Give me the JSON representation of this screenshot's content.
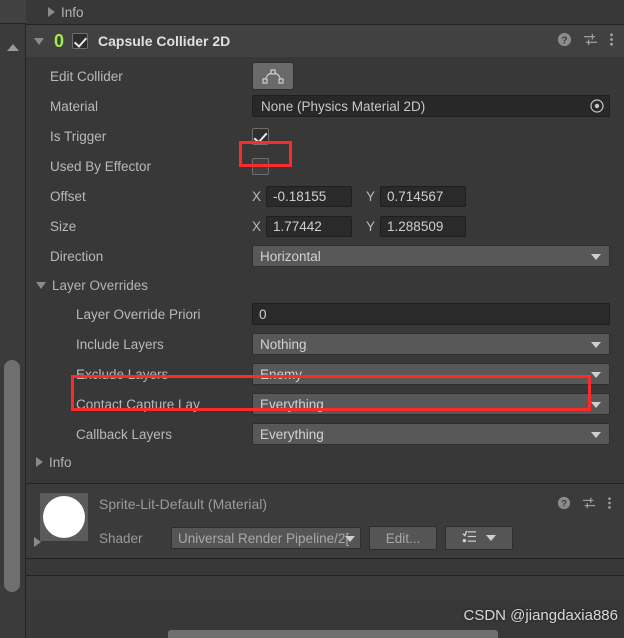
{
  "window": {
    "background_color": "#383838",
    "accent_highlight_color": "#fc2b2b",
    "component_icon_color": "#9cef4a"
  },
  "top_info_row": {
    "label": "Info",
    "expanded": false,
    "triangle_icon": "triangle-right-icon"
  },
  "component_header": {
    "foldout_icon": "triangle-down-icon",
    "component_icon": "0",
    "enabled": true,
    "title": "Capsule Collider 2D",
    "icons": [
      {
        "name": "help-icon",
        "glyph": "?"
      },
      {
        "name": "preset-icon",
        "glyph": "sliders"
      },
      {
        "name": "more-menu-icon",
        "glyph": "kebab"
      }
    ]
  },
  "fields": {
    "edit_collider": {
      "label": "Edit Collider",
      "button_icon": "collider-edit-icon"
    },
    "material": {
      "label": "Material",
      "value": "None (Physics Material 2D)",
      "picker_icon": "object-picker-icon"
    },
    "is_trigger": {
      "label": "Is Trigger",
      "checked": true,
      "highlighted": true
    },
    "used_by_effector": {
      "label": "Used By Effector",
      "checked": false
    },
    "offset": {
      "label": "Offset",
      "x_axis": "X",
      "x_value": "-0.18155",
      "y_axis": "Y",
      "y_value": "0.714567"
    },
    "size": {
      "label": "Size",
      "x_axis": "X",
      "x_value": "1.77442",
      "y_axis": "Y",
      "y_value": "1.288509"
    },
    "direction": {
      "label": "Direction",
      "value": "Horizontal"
    }
  },
  "layer_overrides": {
    "section_label": "Layer Overrides",
    "expanded": true,
    "rows": [
      {
        "label": "Layer Override Priori",
        "value": "0",
        "kind": "text"
      },
      {
        "label": "Include Layers",
        "value": "Nothing",
        "kind": "popup"
      },
      {
        "label": "Exclude Layers",
        "value": "Enemy",
        "kind": "popup",
        "highlighted": true
      },
      {
        "label": "Contact Capture Lay",
        "value": "Everything",
        "kind": "popup"
      },
      {
        "label": "Callback Layers",
        "value": "Everything",
        "kind": "popup"
      }
    ]
  },
  "bottom_info_row": {
    "label": "Info",
    "expanded": false,
    "triangle_icon": "triangle-right-icon"
  },
  "material_block": {
    "expand_icon": "triangle-right-icon",
    "preview_icon": "material-sphere-preview",
    "title": "Sprite-Lit-Default (Material)",
    "icons": [
      {
        "name": "help-icon",
        "glyph": "?"
      },
      {
        "name": "preset-icon",
        "glyph": "sliders"
      },
      {
        "name": "more-menu-icon",
        "glyph": "kebab"
      }
    ],
    "shader_label": "Shader",
    "shader_value": "Universal Render Pipeline/2[",
    "edit_button": "Edit...",
    "list_button_icon": "shader-list-icon"
  },
  "scrollbar": {
    "up_arrow_icon": "triangle-up-icon",
    "thumb": "vertical-scroll-thumb"
  },
  "watermark": {
    "text": "CSDN @jiangdaxia886"
  }
}
